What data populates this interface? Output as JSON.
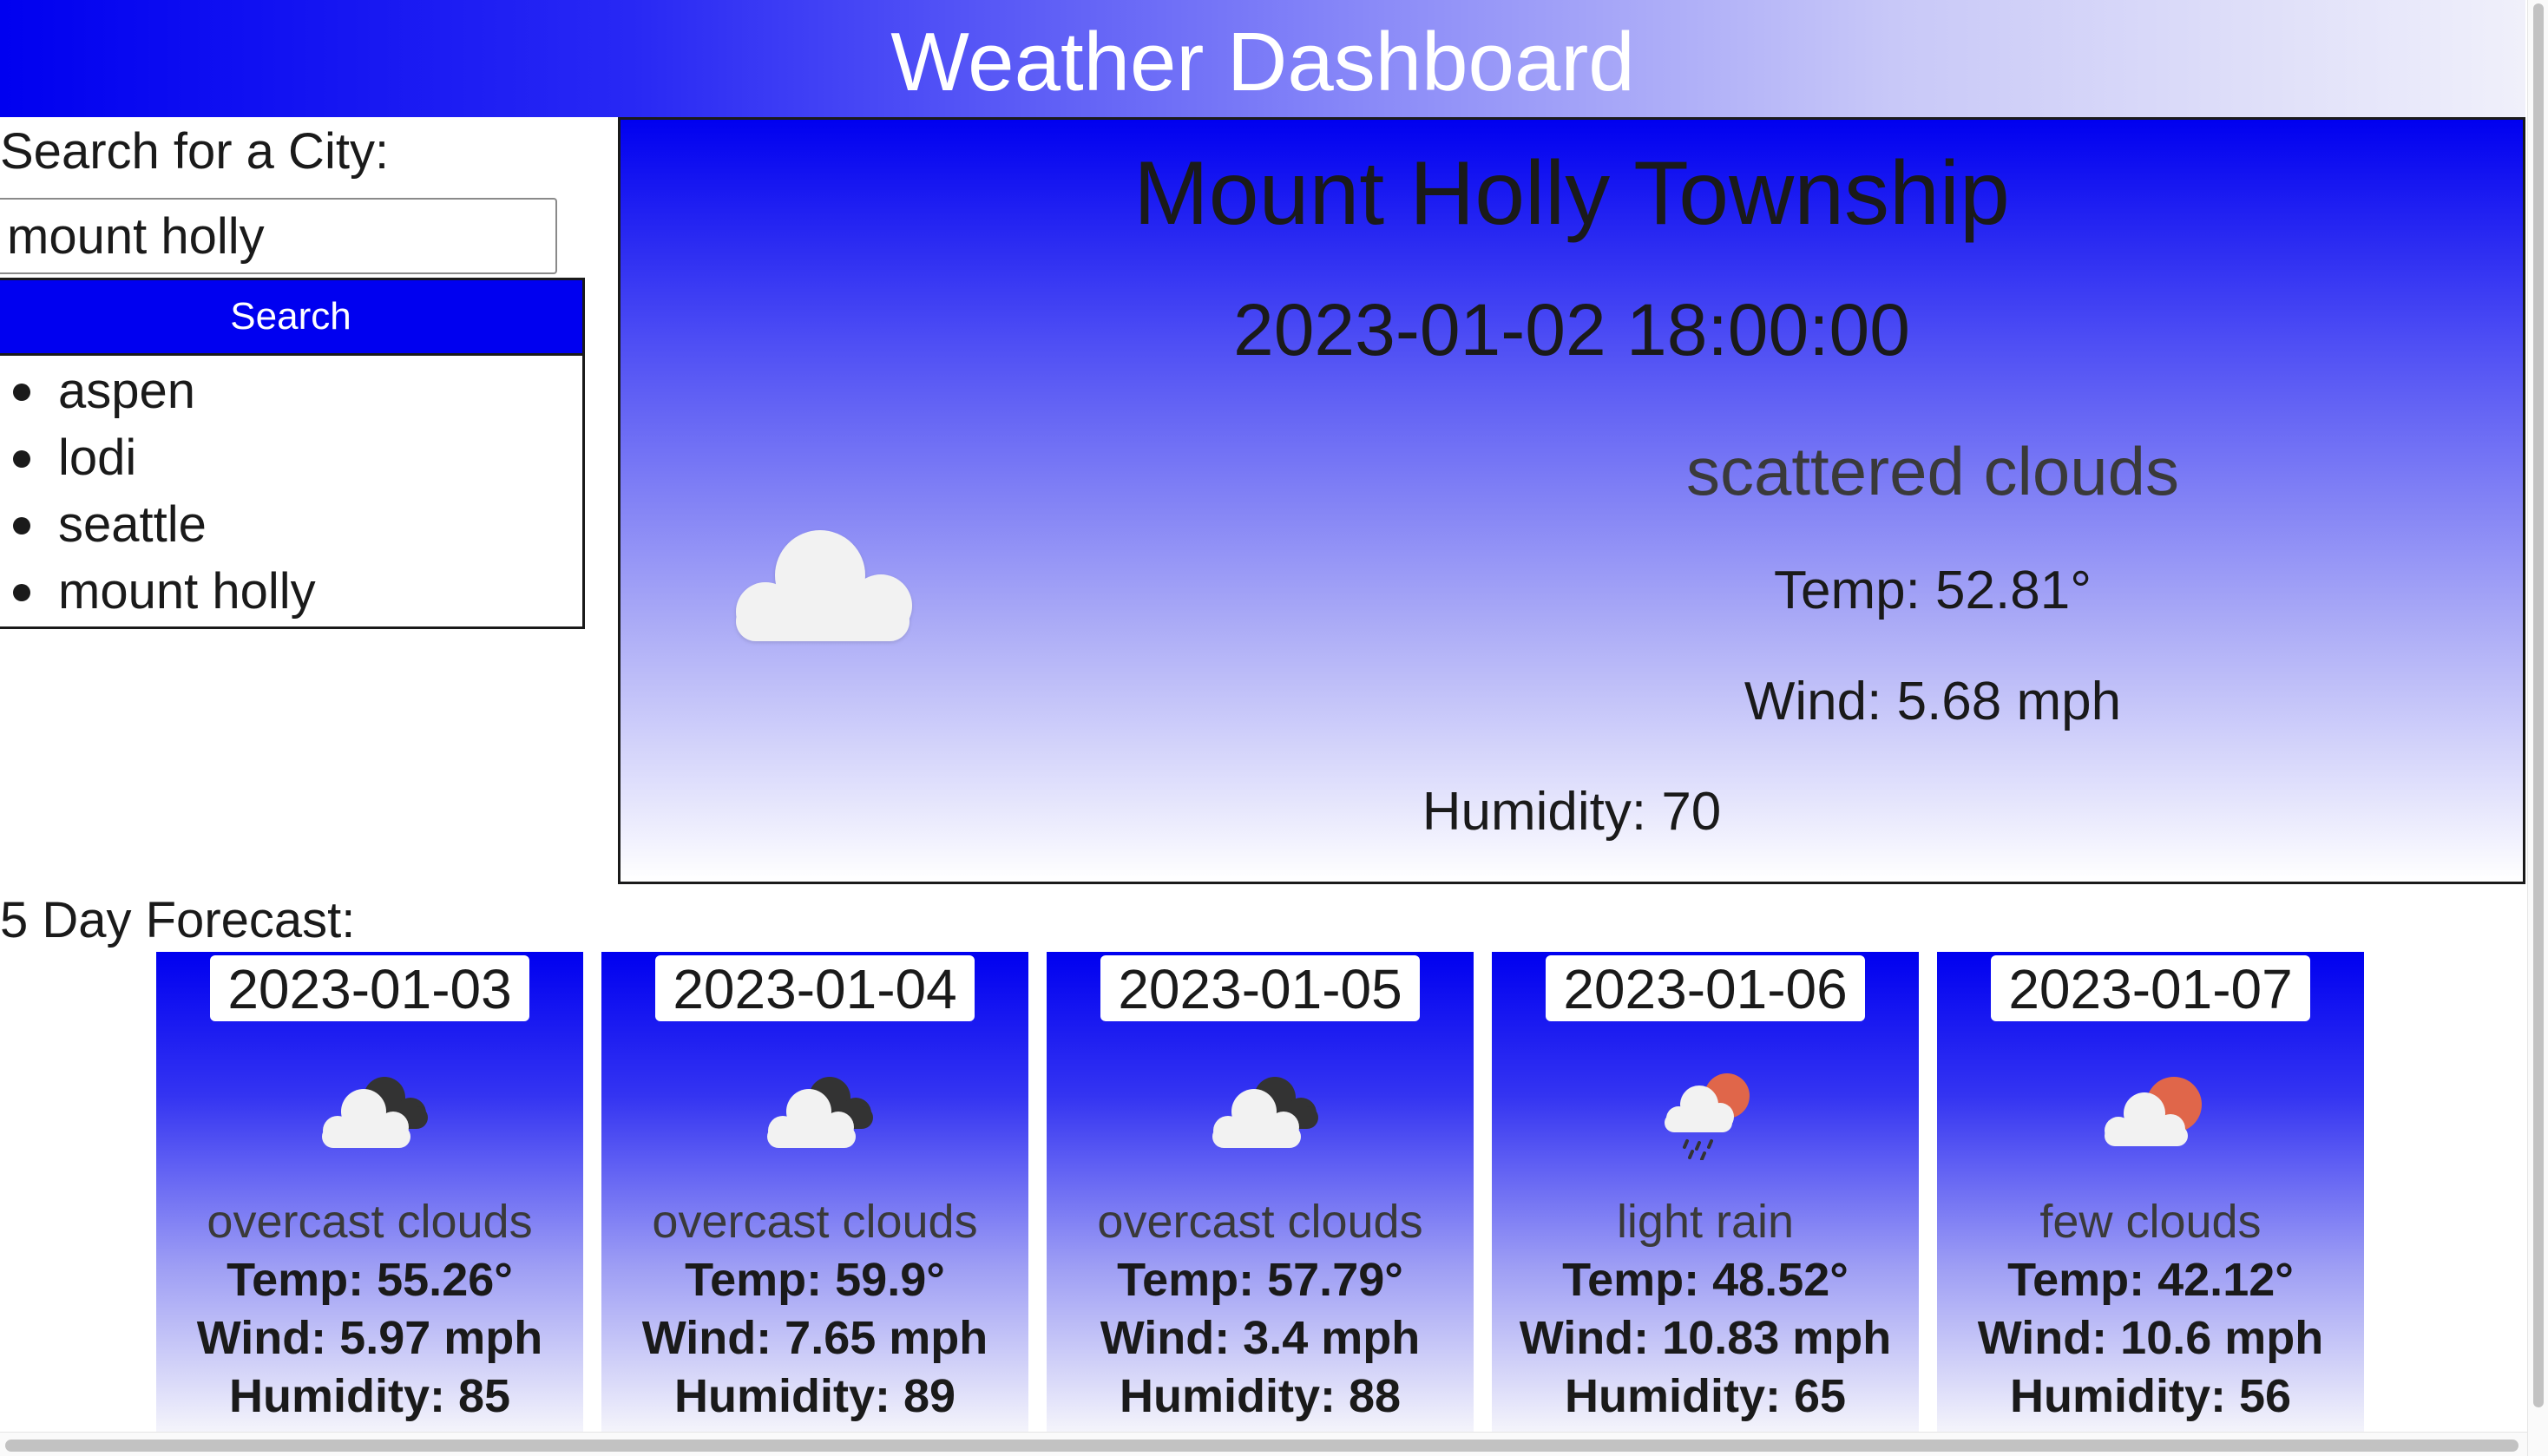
{
  "header": {
    "title": "Weather Dashboard"
  },
  "search": {
    "label": "Search for a City:",
    "input_value": "mount holly",
    "button_label": "Search",
    "history": [
      "aspen",
      "lodi",
      "seattle",
      "mount holly"
    ]
  },
  "current": {
    "city": "Mount Holly Township",
    "datetime": "2023-01-02 18:00:00",
    "icon": "cloud-icon",
    "description": "scattered clouds",
    "temp": "Temp: 52.81°",
    "wind": "Wind: 5.68 mph",
    "humidity": "Humidity: 70"
  },
  "forecast": {
    "label": "5 Day Forecast:",
    "days": [
      {
        "date": "2023-01-03",
        "icon": "overcast-clouds-icon",
        "description": "overcast clouds",
        "temp": "Temp: 55.26°",
        "wind": "Wind: 5.97 mph",
        "humidity": "Humidity: 85"
      },
      {
        "date": "2023-01-04",
        "icon": "overcast-clouds-icon",
        "description": "overcast clouds",
        "temp": "Temp: 59.9°",
        "wind": "Wind: 7.65 mph",
        "humidity": "Humidity: 89"
      },
      {
        "date": "2023-01-05",
        "icon": "overcast-clouds-icon",
        "description": "overcast clouds",
        "temp": "Temp: 57.79°",
        "wind": "Wind: 3.4 mph",
        "humidity": "Humidity: 88"
      },
      {
        "date": "2023-01-06",
        "icon": "rain-sun-icon",
        "description": "light rain",
        "temp": "Temp: 48.52°",
        "wind": "Wind: 10.83 mph",
        "humidity": "Humidity: 65"
      },
      {
        "date": "2023-01-07",
        "icon": "few-clouds-icon",
        "description": "few clouds",
        "temp": "Temp: 42.12°",
        "wind": "Wind: 10.6 mph",
        "humidity": "Humidity: 56"
      }
    ]
  },
  "colors": {
    "accent": "#0000f0",
    "sun": "#e0664a",
    "cloud": "#f2f2f2",
    "dark_cloud": "#333333"
  }
}
